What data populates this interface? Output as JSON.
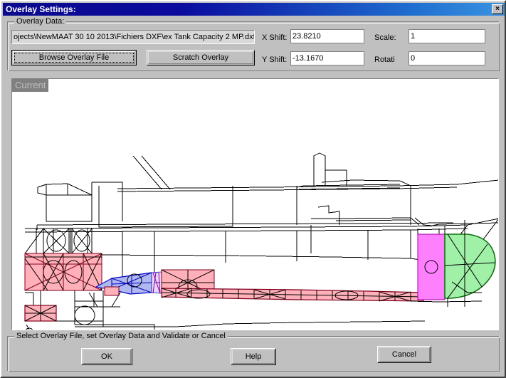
{
  "window": {
    "title": "Overlay Settings:",
    "close_label": "×",
    "close_icon": "close-icon"
  },
  "overlay_group": {
    "label": "Overlay Data:",
    "path_field": {
      "value": "ojects\\NewMAAT 30 10 2013\\Fichiers DXF\\ex Tank Capacity 2 MP.dxf",
      "placeholder": ""
    },
    "browse_button": "Browse Overlay File",
    "scratch_button": "Scratch Overlay",
    "fields": {
      "x_shift_label": "X Shift:",
      "x_shift_value": "23.8210",
      "y_shift_label": "Y Shift:",
      "y_shift_value": "-13.1670",
      "scale_label": "Scale:",
      "scale_value": "1",
      "rotation_label": "Rotati",
      "rotation_value": "0"
    }
  },
  "canvas": {
    "badge": "Current"
  },
  "footer": {
    "label": "Select Overlay File, set Overlay Data and Validate or Cancel",
    "ok_button": "OK",
    "help_button": "Help",
    "cancel_button": "Cancel"
  },
  "colors": {
    "titlebar_start": "#0a0a8c",
    "titlebar_end": "#3a93e0",
    "dialog_face": "#c0c0c0",
    "canvas_bg": "#ffffff",
    "tank_pink": "#ffb0b8",
    "tank_pink_stroke": "#800020",
    "tank_blue": "#b0b8f0",
    "tank_blue_stroke": "#0000c0",
    "tank_magenta": "#ff80ff",
    "tank_magenta_stroke": "#a000a0",
    "tank_green": "#a0f0a8",
    "tank_green_stroke": "#107010",
    "badge_bg": "#808080",
    "badge_fg": "#c0c0c0",
    "hull_line": "#000000"
  }
}
